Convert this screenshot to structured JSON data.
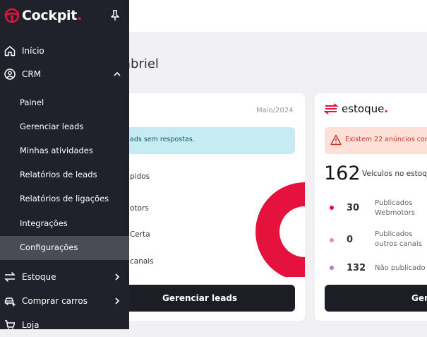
{
  "brand": {
    "name": "Cockpit",
    "dot": "."
  },
  "main": {
    "greeting": "abriel",
    "leads_card": {
      "month": "Maio/2024",
      "banner": "ads sem respostas.",
      "rows": [
        "pidos",
        "otors",
        "Certa",
        "canais"
      ],
      "button": "Gerenciar leads"
    },
    "estoque_card": {
      "logo": "estoque",
      "logo_dot": ".",
      "warning": "Existem 22 anúncios com",
      "total": "162",
      "total_label": "Veículos no estoq",
      "stats": [
        {
          "value": "30",
          "label_line1": "Publicados",
          "label_line2": "Webmotors",
          "color": "#e4123c"
        },
        {
          "value": "0",
          "label_line1": "Publicados",
          "label_line2": "outros canais",
          "color": "#f28ca0"
        },
        {
          "value": "132",
          "label_line1": "Não publicado",
          "label_line2": "",
          "color": "#a97ad6"
        }
      ],
      "button": "Ger"
    }
  },
  "sidebar": {
    "items": [
      {
        "label": "Início",
        "icon": "home-icon"
      },
      {
        "label": "CRM",
        "icon": "user-circle-icon"
      }
    ],
    "crm_sub": [
      "Painel",
      "Gerenciar leads",
      "Minhas atividades",
      "Relatórios de leads",
      "Relatórios de ligações",
      "Integrações",
      "Configurações"
    ],
    "lower_items": [
      {
        "label": "Estoque",
        "icon": "exchange-icon"
      },
      {
        "label": "Comprar carros",
        "icon": "car-plus-icon"
      },
      {
        "label": "Loja",
        "icon": "cart-icon"
      }
    ]
  },
  "colors": {
    "accent": "#e4123c",
    "sidebar_bg": "#20212a",
    "active_item": "#4a4b55"
  },
  "chart_data": {
    "type": "pie",
    "values": [
      100
    ],
    "labels": [
      ""
    ],
    "colors": [
      "#e4123c"
    ]
  }
}
